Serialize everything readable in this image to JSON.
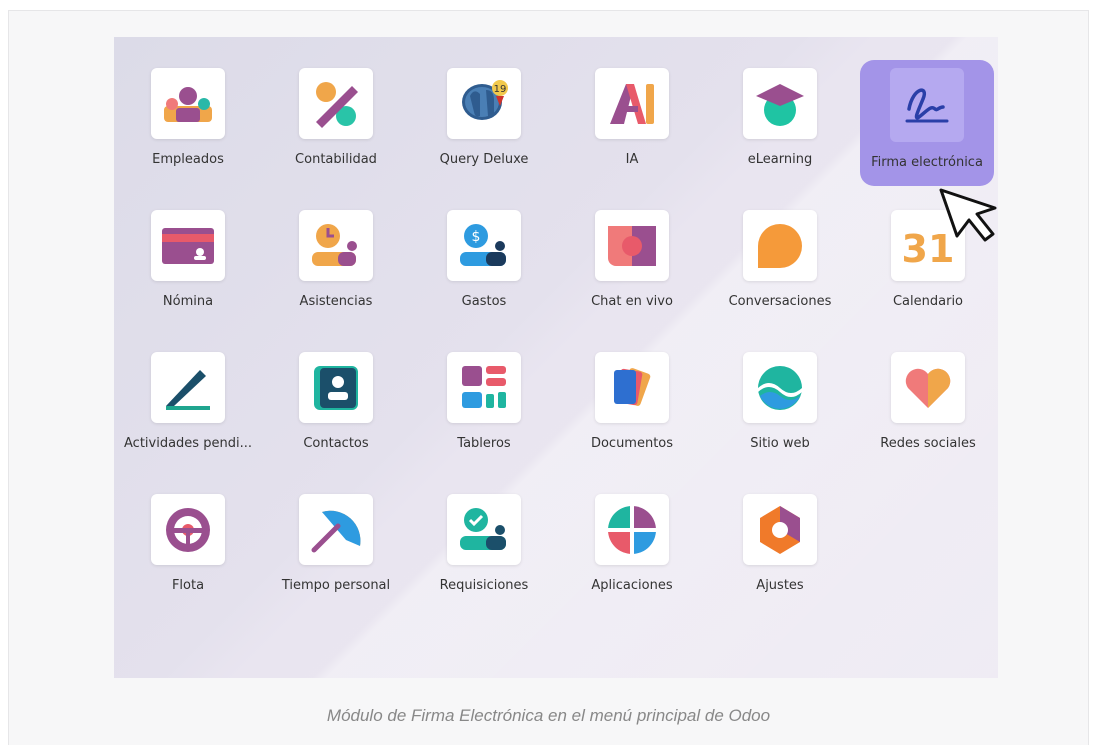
{
  "apps": [
    {
      "label": "Empleados",
      "icon": "employees-icon"
    },
    {
      "label": "Contabilidad",
      "icon": "accounting-icon"
    },
    {
      "label": "Query Deluxe",
      "icon": "query-deluxe-icon",
      "badge": "19"
    },
    {
      "label": "IA",
      "icon": "ai-icon"
    },
    {
      "label": "eLearning",
      "icon": "elearning-icon"
    },
    {
      "label": "Firma electrónica",
      "icon": "signature-icon",
      "selected": true
    },
    {
      "label": "Nómina",
      "icon": "payroll-icon"
    },
    {
      "label": "Asistencias",
      "icon": "attendance-icon"
    },
    {
      "label": "Gastos",
      "icon": "expenses-icon"
    },
    {
      "label": "Chat en vivo",
      "icon": "live-chat-icon"
    },
    {
      "label": "Conversaciones",
      "icon": "discuss-icon"
    },
    {
      "label": "Calendario",
      "icon": "calendar-icon",
      "day": "31"
    },
    {
      "label": "Actividades pendi...",
      "icon": "activities-icon"
    },
    {
      "label": "Contactos",
      "icon": "contacts-icon"
    },
    {
      "label": "Tableros",
      "icon": "dashboards-icon"
    },
    {
      "label": "Documentos",
      "icon": "documents-icon"
    },
    {
      "label": "Sitio web",
      "icon": "website-icon"
    },
    {
      "label": "Redes sociales",
      "icon": "social-icon"
    },
    {
      "label": "Flota",
      "icon": "fleet-icon"
    },
    {
      "label": "Tiempo personal",
      "icon": "time-off-icon"
    },
    {
      "label": "Requisiciones",
      "icon": "requisitions-icon"
    },
    {
      "label": "Aplicaciones",
      "icon": "apps-icon"
    },
    {
      "label": "Ajustes",
      "icon": "settings-icon"
    }
  ],
  "caption": "Módulo de Firma Electrónica en el menú principal de Odoo",
  "colors": {
    "selected_bg": "#a394e8",
    "caption": "#888888"
  }
}
